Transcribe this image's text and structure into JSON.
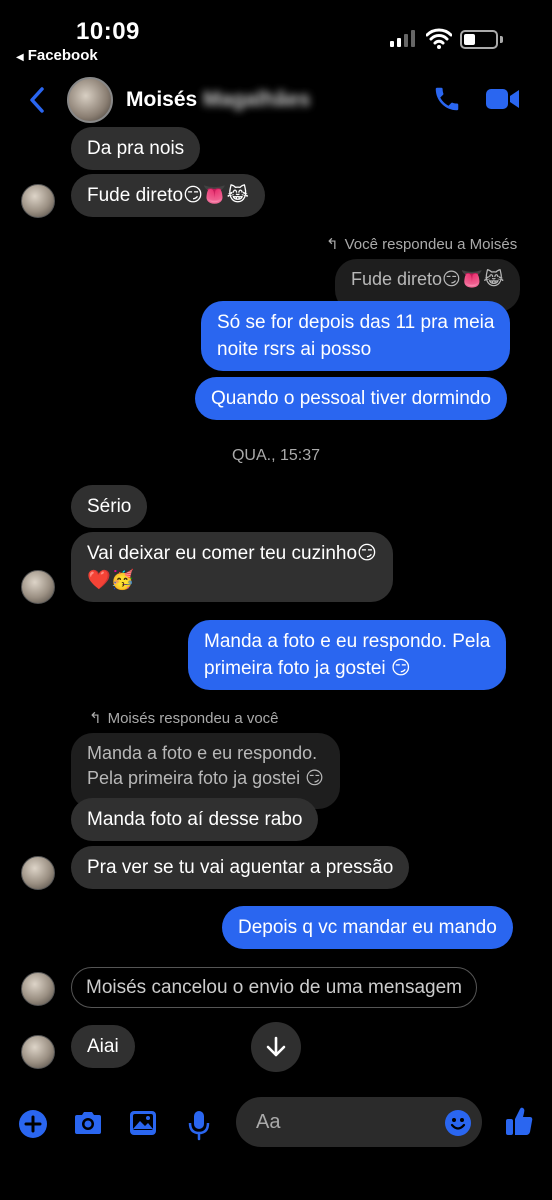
{
  "status": {
    "time": "10:09",
    "back_app": "Facebook"
  },
  "header": {
    "name_visible": "Moisés",
    "name_blurred": "Magalhães"
  },
  "messages": {
    "m1": "Da pra nois",
    "m2": "Fude direto😏👅😹",
    "reply1_note": "Você respondeu a Moisés",
    "reply1_quote": "Fude direto😏👅😹",
    "m3_line1": "Só se for depois das 11 pra meia",
    "m3_line2": "noite rsrs ai posso",
    "m4": "Quando o pessoal tiver dormindo",
    "timestamp": "QUA., 15:37",
    "m5": "Sério",
    "m6_line1": "Vai deixar eu comer teu cuzinho😏",
    "m6_line2": "❤️🥳",
    "m7_line1": "Manda a foto e eu respondo. Pela",
    "m7_line2": "primeira foto ja gostei 😏",
    "reply2_note": "Moisés respondeu a você",
    "reply2_quote_line1": "Manda a foto e eu respondo.",
    "reply2_quote_line2": "Pela primeira foto ja gostei 😏",
    "m8": "Manda foto aí desse rabo",
    "m9": "Pra ver se tu vai aguentar a pressão",
    "m10": "Depois q vc mandar eu mando",
    "m11": "Moisés cancelou o envio de uma mensagem",
    "m12": "Aiai"
  },
  "composer": {
    "placeholder": "Aa"
  },
  "colors": {
    "accent": "#2a66f0",
    "incoming_bubble": "#303030",
    "background": "#000000"
  },
  "icons": [
    "back-arrow-icon",
    "phone-icon",
    "video-camera-icon",
    "plus-icon",
    "camera-icon",
    "image-icon",
    "microphone-icon",
    "emoji-icon",
    "thumbs-up-icon",
    "arrow-down-icon",
    "reply-arrow-icon"
  ]
}
